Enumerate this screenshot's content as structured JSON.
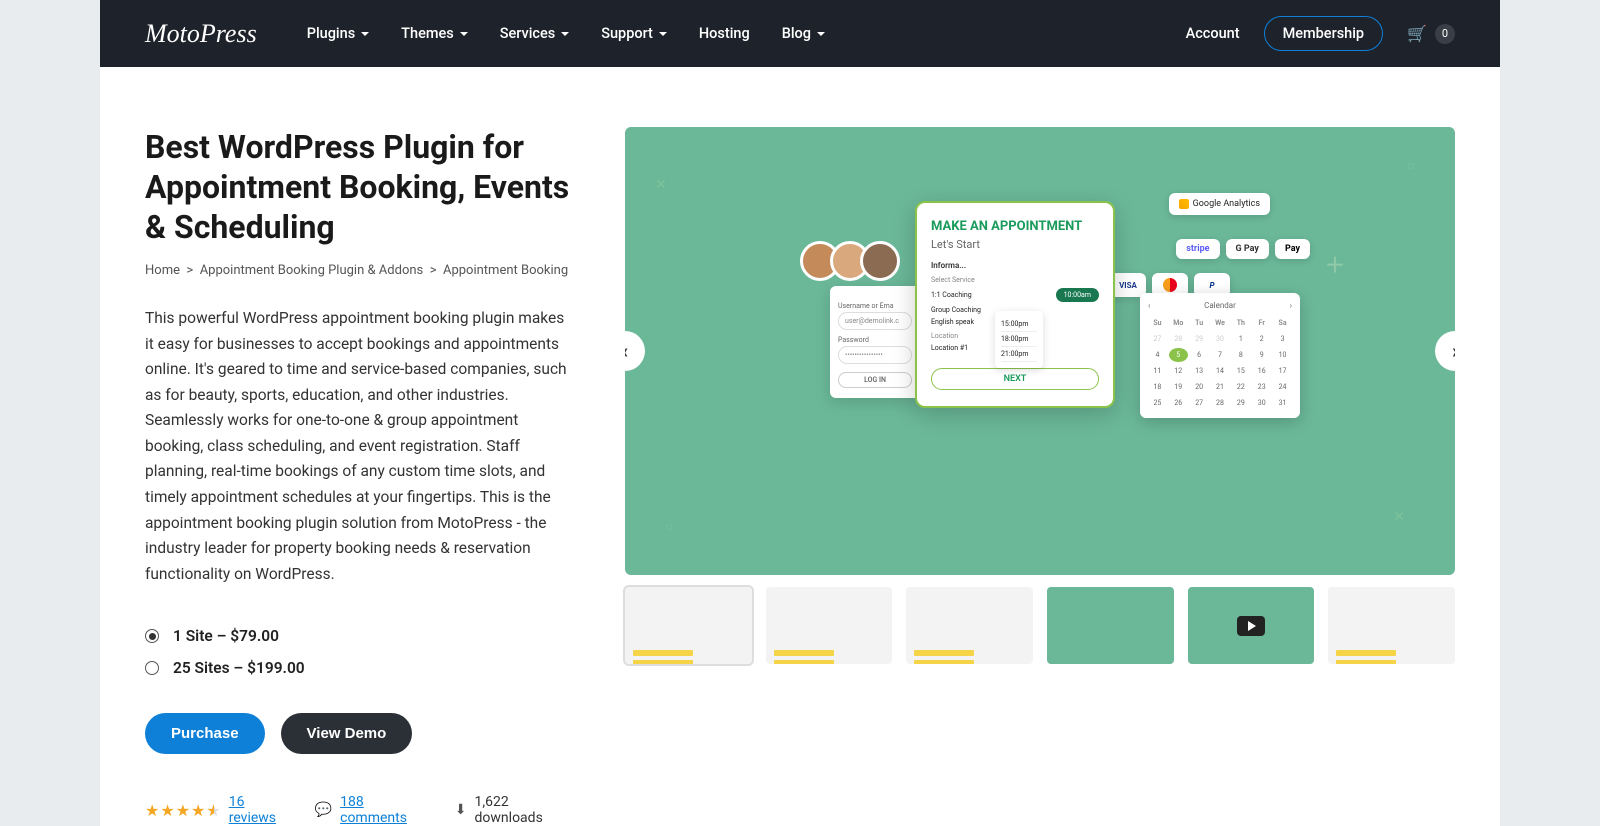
{
  "header": {
    "logo": "MotoPress",
    "nav": [
      "Plugins",
      "Themes",
      "Services",
      "Support",
      "Hosting",
      "Blog"
    ],
    "account": "Account",
    "membership": "Membership",
    "cart_count": "0"
  },
  "product": {
    "title": "Best WordPress Plugin for Appointment Booking, Events & Scheduling",
    "breadcrumb": {
      "home": "Home",
      "cat": "Appointment Booking Plugin & Addons",
      "current": "Appointment Booking"
    },
    "description": "This powerful WordPress appointment booking plugin makes it easy for businesses to accept bookings and appointments online. It's geared to time and service-based companies, such as for beauty, sports, education, and other industries. Seamlessly works for one-to-one & group appointment booking, class scheduling, and event registration. Staff planning, real-time bookings of any custom time slots, and timely appointment schedules at your fingertips. This is the appointment booking plugin solution from MotoPress - the industry leader for property booking needs & reservation functionality on WordPress.",
    "options": [
      {
        "label": "1 Site – $79.00",
        "selected": true
      },
      {
        "label": "25 Sites – $199.00",
        "selected": false
      }
    ],
    "purchase": "Purchase",
    "view_demo": "View Demo",
    "reviews": "16 reviews",
    "comments": "188 comments",
    "downloads": "1,622 downloads"
  },
  "mockup": {
    "ga": "Google\nAnalytics",
    "appt_title": "MAKE AN APPOINTMENT",
    "appt_sub": "Let's Start",
    "appt_info": "Informa...",
    "select_service": "Select Service",
    "services": [
      "1:1 Coaching",
      "Group Coaching",
      "English speak"
    ],
    "slot": "10:00am",
    "location_lbl": "Location",
    "location_val": "Location #1",
    "next": "NEXT",
    "login_user_lbl": "Username or Ema",
    "login_user": "user@demolink.c",
    "login_pw_lbl": "Password",
    "login_pw": "••••••••••••••••",
    "login_btn": "LOG IN",
    "times": [
      "15:00pm",
      "18:00pm",
      "21:00pm"
    ],
    "cal_title": "Calendar",
    "cal_days": [
      "Su",
      "Mo",
      "Tu",
      "We",
      "Th",
      "Fr",
      "Sa"
    ],
    "cal_cells": [
      "27",
      "28",
      "29",
      "30",
      "1",
      "2",
      "3",
      "4",
      "5",
      "6",
      "7",
      "8",
      "9",
      "10",
      "11",
      "12",
      "13",
      "14",
      "15",
      "16",
      "17",
      "18",
      "19",
      "20",
      "21",
      "22",
      "23",
      "24",
      "25",
      "26",
      "27",
      "28",
      "29",
      "30",
      "31"
    ],
    "stripe": "stripe",
    "gpay": "G Pay",
    "apay": "Pay",
    "visa": "VISA",
    "pp": "P"
  }
}
